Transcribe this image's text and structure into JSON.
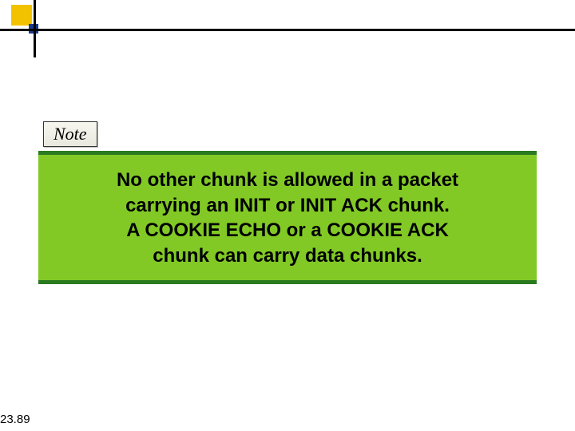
{
  "logo": {
    "yellow_square": "decorative-yellow-square",
    "blue_square": "decorative-blue-square"
  },
  "note": {
    "label": "Note"
  },
  "callout": {
    "line1": "No other chunk is allowed in a packet",
    "line2": "carrying an INIT or INIT ACK chunk.",
    "line3": "A COOKIE ECHO or a COOKIE ACK",
    "line4": "chunk can carry data chunks."
  },
  "page_number": "23.89"
}
